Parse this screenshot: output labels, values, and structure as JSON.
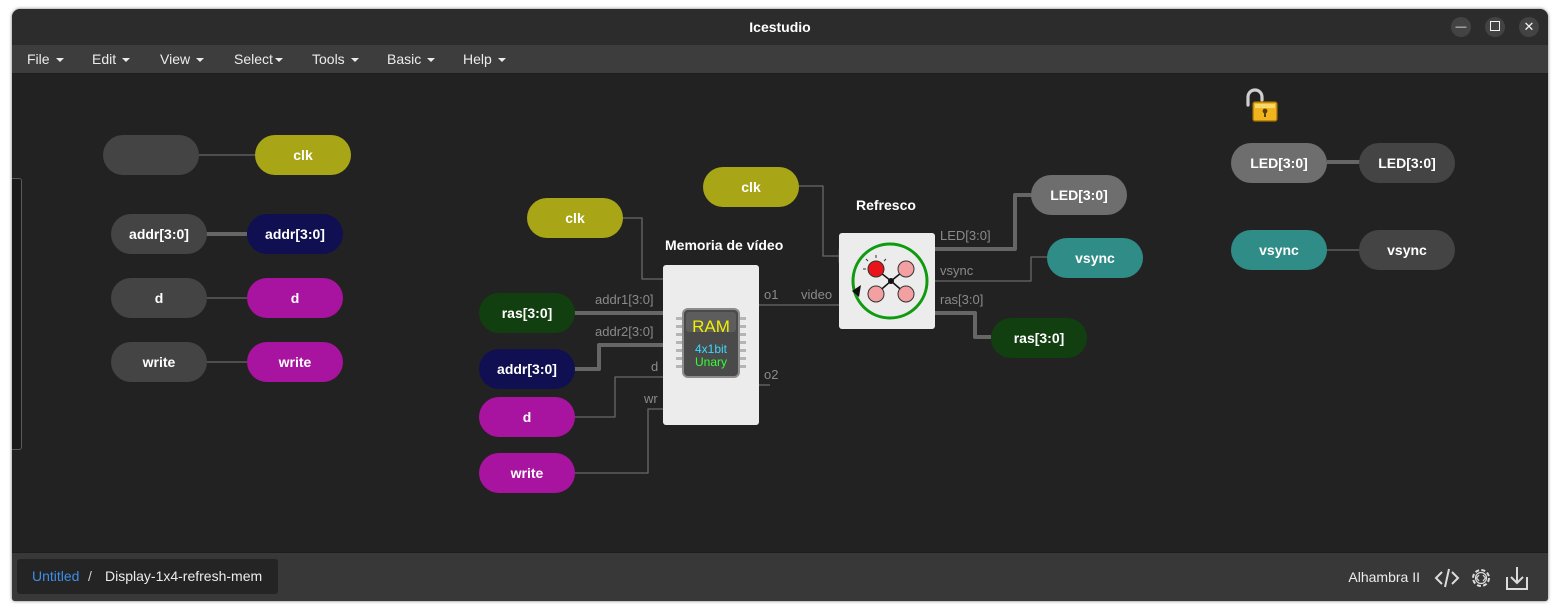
{
  "window": {
    "title": "Icestudio"
  },
  "menu": [
    {
      "label": "File"
    },
    {
      "label": "Edit"
    },
    {
      "label": "View"
    },
    {
      "label": "Select"
    },
    {
      "label": "Tools"
    },
    {
      "label": "Basic"
    },
    {
      "label": "Help"
    }
  ],
  "canvas": {
    "left_group": {
      "clk_in": "",
      "clk_out": "clk",
      "addr_in": "addr[3:0]",
      "addr_out": "addr[3:0]",
      "d_in": "d",
      "d_out": "d",
      "write_in": "write",
      "write_out": "write"
    },
    "memory_block": {
      "title": "Memoria de vídeo",
      "icon_main": "RAM",
      "icon_sub1": "4x1bit",
      "icon_sub2": "Unary",
      "ports_in": [
        "addr1[3:0]",
        "addr2[3:0]",
        "d",
        "wr"
      ],
      "ports_out": [
        "o1",
        "o2"
      ]
    },
    "memory_inputs": {
      "clk": "clk",
      "ras": "ras[3:0]",
      "addr": "addr[3:0]",
      "d": "d",
      "write": "write"
    },
    "wire_label_video": "video",
    "refresh_block": {
      "title": "Refresco",
      "ports_out": [
        "LED[3:0]",
        "vsync",
        "ras[3:0]"
      ]
    },
    "refresh_clk": "clk",
    "refresh_outputs": {
      "led": "LED[3:0]",
      "vsync": "vsync",
      "ras": "ras[3:0]"
    },
    "right_group": {
      "led_in": "LED[3:0]",
      "led_out": "LED[3:0]",
      "vsync_in": "vsync",
      "vsync_out": "vsync"
    }
  },
  "footer": {
    "crumb_root": "Untitled",
    "crumb_sep": "/",
    "crumb_current": "Display-1x4-refresh-mem",
    "board": "Alhambra II"
  },
  "colors": {
    "clk": "#a8a616",
    "addr_dark": "#0f0f52",
    "magenta": "#a8139f",
    "gray_pill": "#444444",
    "light_gray_pill": "#6e6e6e",
    "dark_green": "#123f10",
    "teal": "#2f8c86",
    "link": "#3d8ee6"
  }
}
